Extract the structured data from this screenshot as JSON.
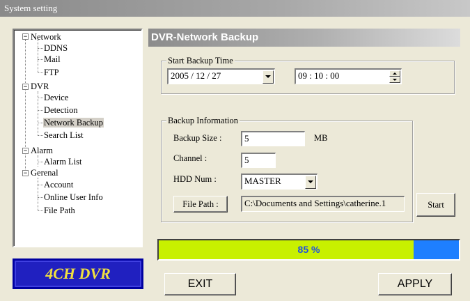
{
  "window": {
    "title": "System setting"
  },
  "tree": {
    "network": {
      "label": "Network",
      "expander": "−",
      "children": [
        "DDNS",
        "Mail",
        "FTP"
      ]
    },
    "dvr": {
      "label": "DVR",
      "expander": "−",
      "children": [
        "Device",
        "Detection",
        "Network Backup",
        "Search List"
      ]
    },
    "alarm": {
      "label": "Alarm",
      "expander": "−",
      "children": [
        "Alarm List"
      ]
    },
    "general": {
      "label": "Gerenal",
      "expander": "−",
      "children": [
        "Account",
        "Online User Info",
        "File Path"
      ]
    },
    "selected": "Network Backup"
  },
  "logo": {
    "text": "4CH DVR",
    "color": "#f0e040",
    "background": "#2020c0"
  },
  "panel": {
    "title": "DVR-Network Backup"
  },
  "start_backup": {
    "group_label": "Start Backup Time",
    "date_value": "2005 / 12 / 27",
    "time_value": "09 : 10 : 00"
  },
  "backup_info": {
    "group_label": "Backup Information",
    "size_label": "Backup Size :",
    "size_value": "5",
    "size_unit": "MB",
    "channel_label": "Channel :",
    "channel_value": "5",
    "hdd_label": "HDD Num :",
    "hdd_value": "MASTER",
    "file_path_button": "File Path :",
    "file_path_value": "C:\\Documents and Settings\\catherine.1"
  },
  "start_button": "Start",
  "progress": {
    "percent": 85,
    "label": "85 %",
    "fill_color": "#c8f000",
    "track_color": "#1e7fff"
  },
  "footer": {
    "exit_label": "EXIT",
    "apply_label": "APPLY"
  }
}
